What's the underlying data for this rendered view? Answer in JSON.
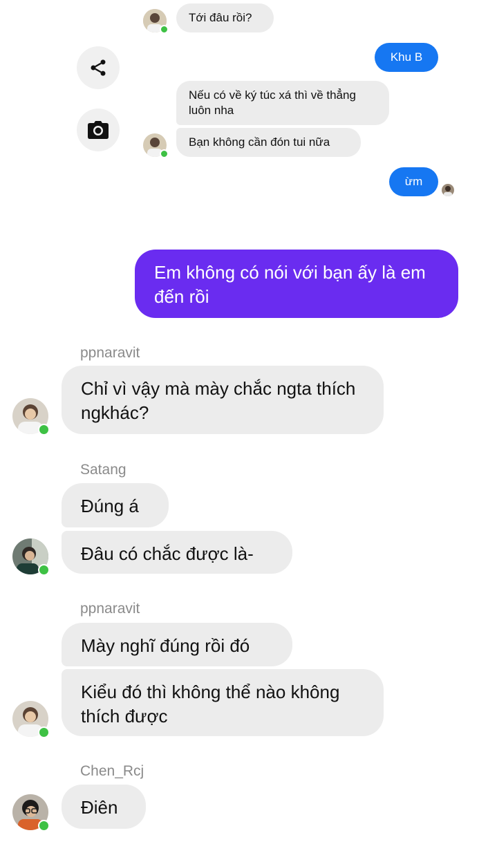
{
  "messages": {
    "m1": "Tới đâu rồi?",
    "m2": "Khu B",
    "m3": "Nếu có về ký túc xá thì về thẳng luôn nha",
    "m4": "Bạn không cần đón tui nữa",
    "m5": "ừm",
    "m6": "Em không có nói với bạn ấy là em đến rồi",
    "m7": "Chỉ vì vậy mà mày chắc ngta thích ngkhác?",
    "m8": "Đúng á",
    "m9": "Đâu có chắc được là-",
    "m10": "Mày nghĩ đúng rồi đó",
    "m11": "Kiểu đó thì không thể nào không thích được",
    "m12": "Điên"
  },
  "senders": {
    "s1": "ppnaravit",
    "s2": "Satang",
    "s3": "ppnaravit",
    "s4": "Chen_Rcj"
  },
  "icons": {
    "share": "share-icon",
    "camera": "camera-icon"
  },
  "colors": {
    "outgoing_blue": "#1677f2",
    "outgoing_purple": "#6a2cf0",
    "incoming": "#ececec",
    "online": "#3ec144"
  }
}
